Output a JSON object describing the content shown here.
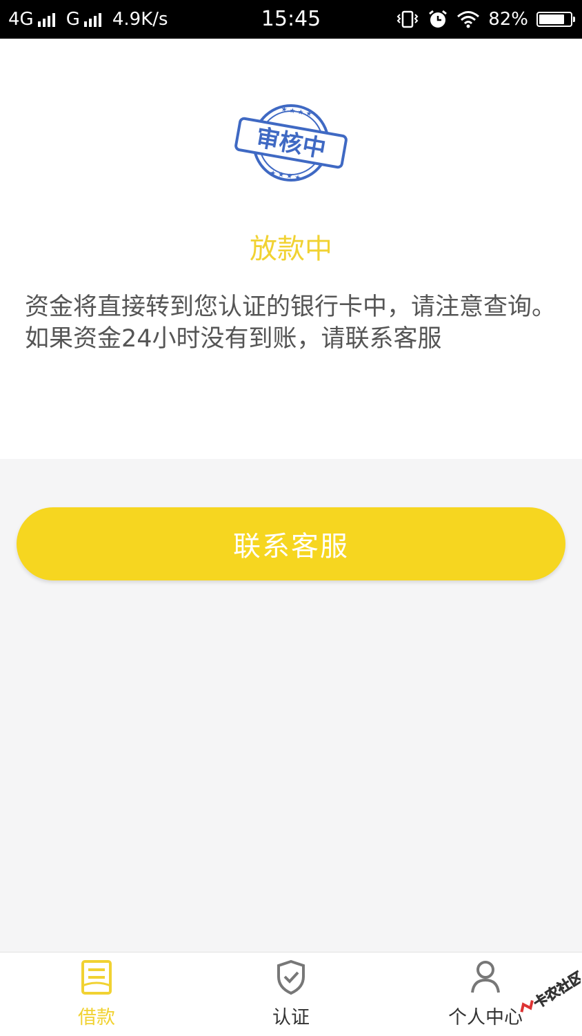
{
  "status_bar": {
    "network1": "4G",
    "network2": "G",
    "speed": "4.9K/s",
    "time": "15:45",
    "battery": "82%",
    "battery_level": 0.82
  },
  "stamp": {
    "text": "审核中",
    "color": "#3f69c3"
  },
  "status": {
    "title": "放款中",
    "description": "资金将直接转到您认证的银行卡中，请注意查询。如果资金24小时没有到账，请联系客服"
  },
  "contact_button": {
    "label": "联系客服"
  },
  "tabs": [
    {
      "label": "借款",
      "icon": "document-icon",
      "active": true
    },
    {
      "label": "认证",
      "icon": "shield-check-icon",
      "active": false
    },
    {
      "label": "个人中心",
      "icon": "person-icon",
      "active": false
    }
  ],
  "watermark": {
    "text": "卡农社区"
  },
  "colors": {
    "accent": "#f6d620",
    "accent_text": "#f1d232",
    "stamp_blue": "#3f69c3",
    "background": "#f5f5f6"
  }
}
